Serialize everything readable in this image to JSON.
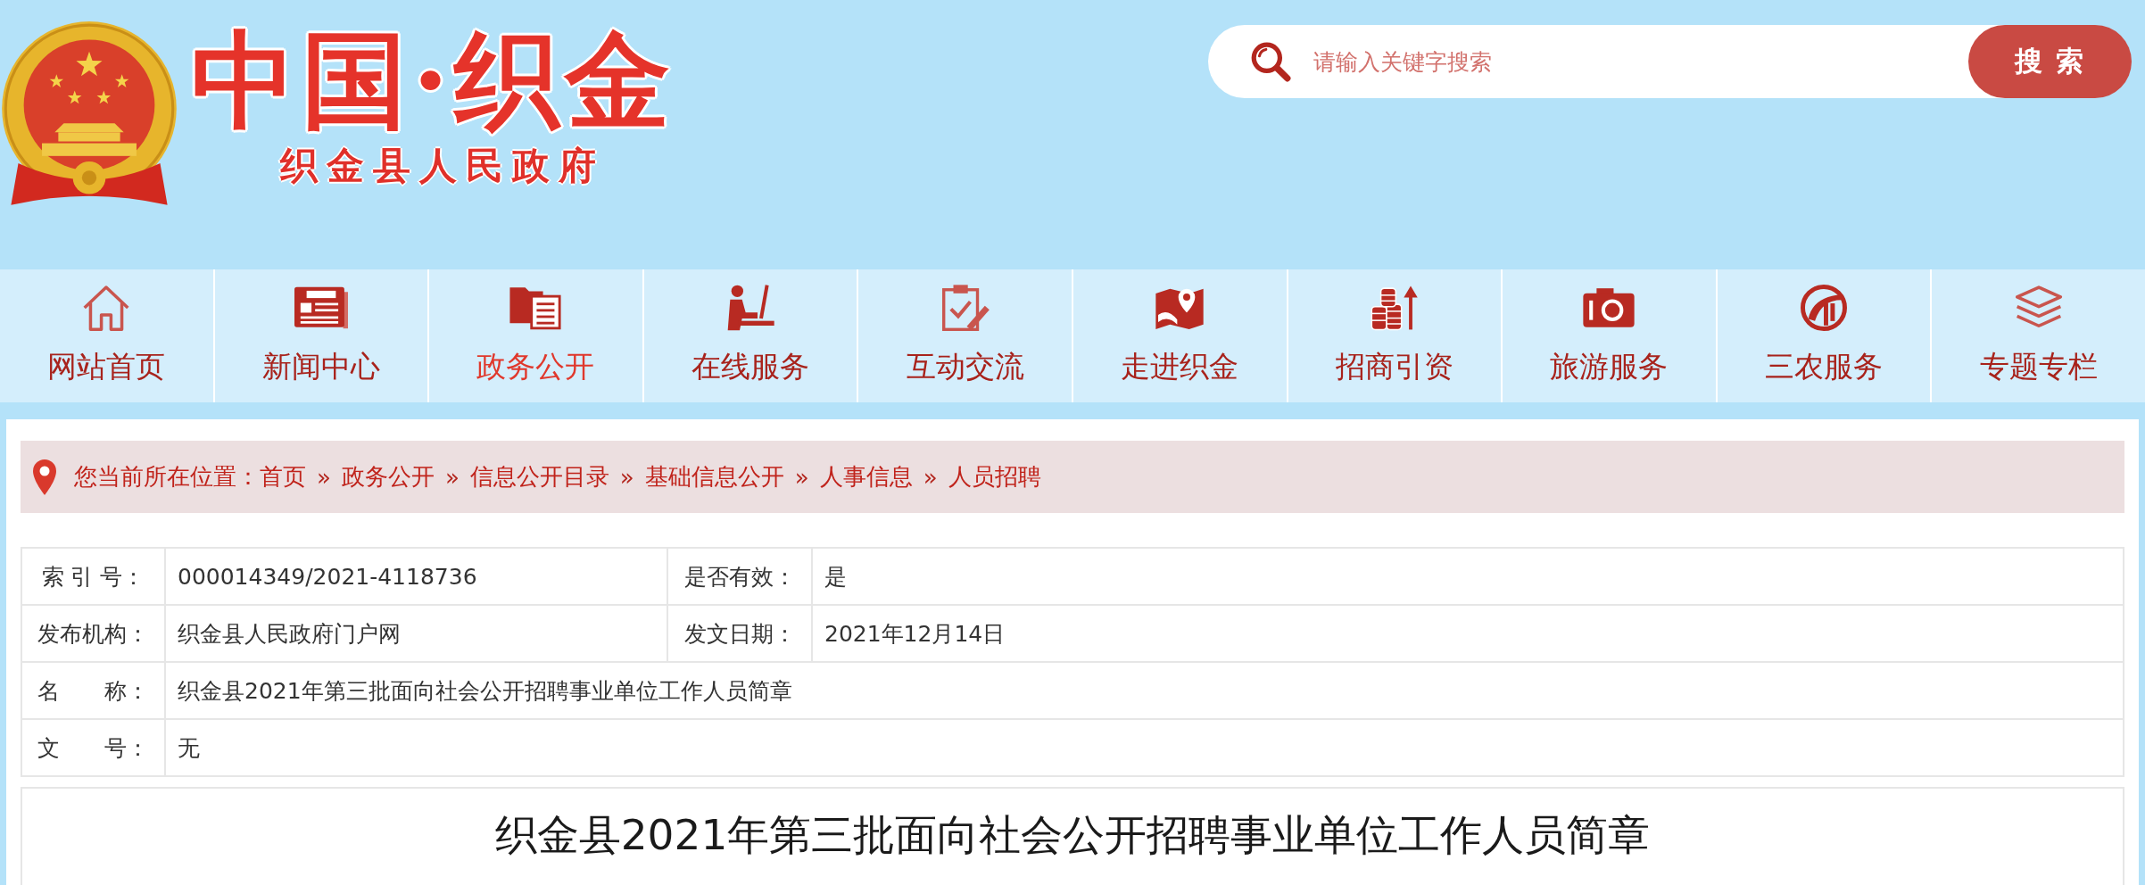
{
  "header": {
    "title": "中国·织金",
    "subtitle": "织金县人民政府"
  },
  "search": {
    "placeholder": "请输入关键字搜索",
    "button": "搜 索"
  },
  "nav": [
    {
      "label": "网站首页",
      "selected": false
    },
    {
      "label": "新闻中心",
      "selected": false
    },
    {
      "label": "政务公开",
      "selected": true
    },
    {
      "label": "在线服务",
      "selected": false
    },
    {
      "label": "互动交流",
      "selected": false
    },
    {
      "label": "走进织金",
      "selected": false
    },
    {
      "label": "招商引资",
      "selected": false
    },
    {
      "label": "旅游服务",
      "selected": false
    },
    {
      "label": "三农服务",
      "selected": false
    },
    {
      "label": "专题专栏",
      "selected": false
    }
  ],
  "breadcrumb": {
    "label": "您当前所在位置：",
    "items": [
      {
        "text": "首页"
      },
      {
        "separator": "»",
        "text": "政务公开"
      },
      {
        "separator": "»",
        "text": "信息公开目录"
      },
      {
        "separator": "»",
        "text": "基础信息公开"
      },
      {
        "separator": "»",
        "text": "人事信息"
      },
      {
        "separator": "»",
        "text": "人员招聘"
      }
    ]
  },
  "info_table": {
    "rows": [
      [
        {
          "label": "索 引 号：",
          "value": "000014349/2021-4118736"
        },
        {
          "label": "是否有效：",
          "value": "是"
        }
      ],
      [
        {
          "label": "发布机构：",
          "value": "织金县人民政府门户网"
        },
        {
          "label": "发文日期：",
          "value": "2021年12月14日"
        }
      ],
      [
        {
          "label": "名　　称：",
          "value": "织金县2021年第三批面向社会公开招聘事业单位工作人员简章"
        }
      ],
      [
        {
          "label": "文　　号：",
          "value": "无"
        }
      ]
    ]
  },
  "article": {
    "title": "织金县2021年第三批面向社会公开招聘事业单位工作人员简章"
  }
}
